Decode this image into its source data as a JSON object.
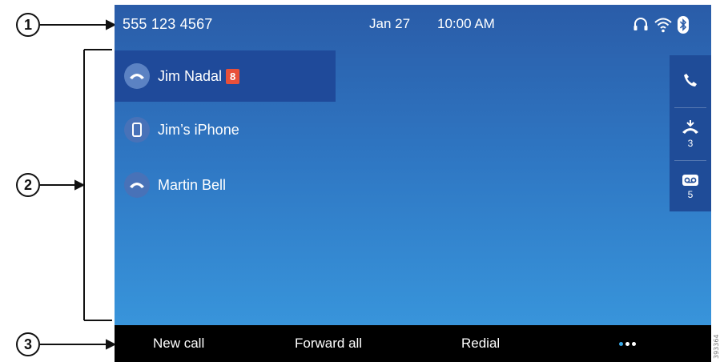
{
  "callouts": {
    "one": "1",
    "two": "2",
    "three": "3"
  },
  "status_bar": {
    "phone_number": "555 123 4567",
    "date": "Jan 27",
    "time": "10:00 AM",
    "icons": [
      "headset-icon",
      "wifi-icon",
      "bluetooth-icon"
    ]
  },
  "lines": [
    {
      "label": "Jim Nadal",
      "badge": "8",
      "icon": "handset-icon",
      "selected": true
    },
    {
      "label": "Jim’s iPhone",
      "icon": "mobile-phone-icon",
      "selected": false
    },
    {
      "label": "Martin Bell",
      "icon": "handset-icon",
      "selected": false
    }
  ],
  "features": {
    "call": {
      "icon": "phone-call-icon"
    },
    "missed": {
      "icon": "missed-calls-icon",
      "count": "3"
    },
    "voicemail": {
      "icon": "voicemail-icon",
      "count": "5"
    }
  },
  "softkeys": {
    "new_call": "New call",
    "forward_all": "Forward all",
    "redial": "Redial",
    "more_icon": "more-options-icon"
  },
  "figure_id": "393364",
  "colors": {
    "screen_top": "#2a5ca8",
    "screen_bottom": "#3a9be0",
    "selected_line": "#1f4a9a",
    "feature_column": "#1f4c98",
    "badge": "#e8503a",
    "softkey_bar": "#000000",
    "more_dot_accent": "#39a8e6"
  }
}
